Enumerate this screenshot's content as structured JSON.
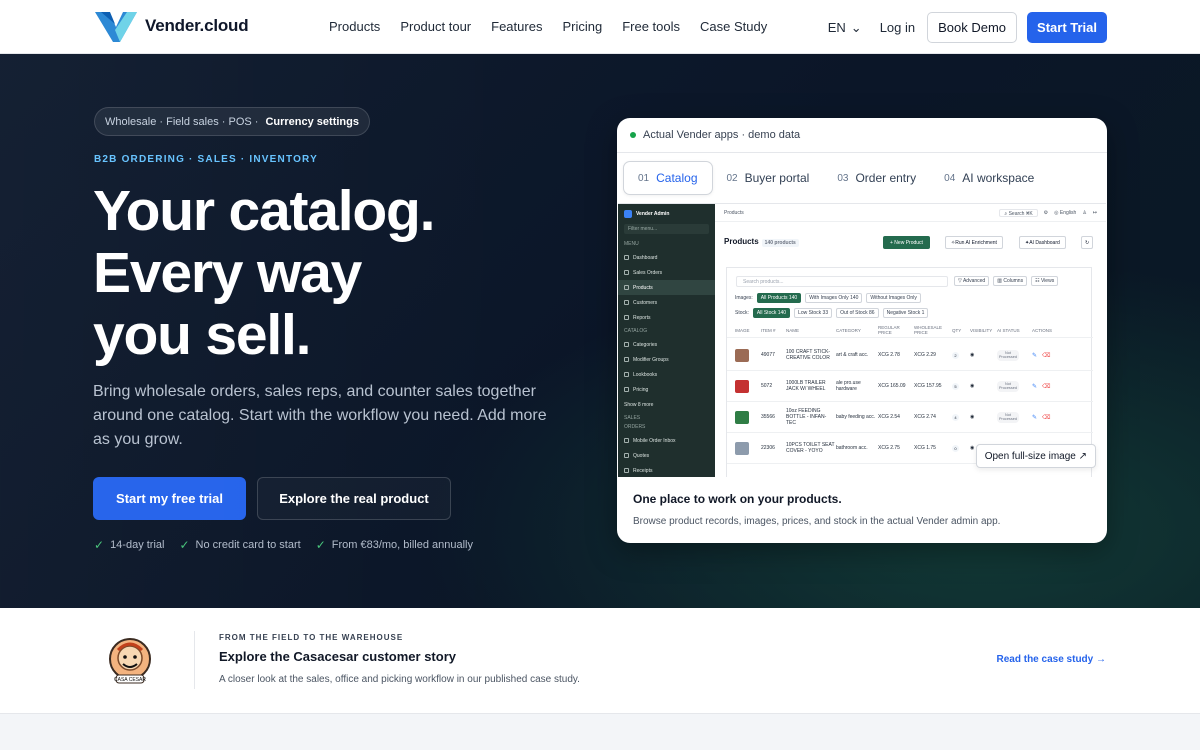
{
  "nav": {
    "brand": "Vender.cloud",
    "items": [
      "Products",
      "Product tour",
      "Features",
      "Pricing",
      "Free tools",
      "Case Study"
    ],
    "language": "EN",
    "login": "Log in",
    "book_demo": "Book Demo",
    "start_trial": "Start Trial",
    "colors": {
      "accent": "#2563eb"
    }
  },
  "hero": {
    "chips": [
      "Wholesale · Field sales · POS ·",
      "Currency settings"
    ],
    "eyebrow": "B2B ORDERING · SALES · INVENTORY",
    "headline": [
      "Your catalog.",
      "Every way",
      "you sell."
    ],
    "lead": "Bring wholesale orders, sales reps, and counter sales together around one catalog. Start with the workflow you need. Add more as you grow.",
    "primary_cta": "Start my free trial",
    "secondary_cta": "Explore the real product",
    "checks": [
      "14-day trial",
      "No credit card to start",
      "From €83/mo, billed annually"
    ],
    "colors": {
      "eyebrow": "#66c3ff",
      "check": "#47c47a"
    }
  },
  "demo_card": {
    "status": "Actual Vender apps · demo data",
    "tabs": [
      {
        "num": "01",
        "label": "Catalog"
      },
      {
        "num": "02",
        "label": "Buyer portal"
      },
      {
        "num": "03",
        "label": "Order entry"
      },
      {
        "num": "04",
        "label": "AI workspace"
      }
    ],
    "screenshot": {
      "sidebar": {
        "title": "Vender Admin",
        "search": "Filter menu...",
        "sections": [
          "MENU",
          "CATALOG",
          "SALES",
          "ORDERS"
        ],
        "items": [
          "Dashboard",
          "Sales Orders",
          "Products",
          "Customers",
          "Reports",
          "Categories",
          "Modifier Groups",
          "Lookbooks",
          "Pricing",
          "Show 8 more",
          "Mobile Order Inbox",
          "Quotes",
          "Receipts"
        ]
      },
      "breadcrumb": "Products",
      "top_search": "Search",
      "top_shortcut": "⌘K",
      "language": "English",
      "title": "Products",
      "count": "140 products",
      "buttons": [
        "+ New Product",
        "Run AI Enrichment",
        "AI Dashboard"
      ],
      "search_placeholder": "Search products...",
      "toolbar": [
        "Advanced",
        "Columns",
        "Views"
      ],
      "images_label": "Images:",
      "images_filters": [
        "All Products 140",
        "With Images Only 140",
        "Without Images Only"
      ],
      "stock_label": "Stock:",
      "stock_filters": [
        "All Stock 140",
        "Low Stock 33",
        "Out of Stock 86",
        "Negative Stock 1"
      ],
      "columns": [
        "IMAGE",
        "ITEM #",
        "NAME",
        "CATEGORY",
        "REGULAR PRICE",
        "WHOLESALE PRICE",
        "QTY",
        "VISIBILITY",
        "AI STATUS",
        "ACTIONS"
      ],
      "rows": [
        {
          "item": "49077",
          "name": "100 CRAFT STICK-CREATIVE COLOR",
          "category": "art & craft acc.",
          "regular": "XCG 2.78",
          "wholesale": "XCG 2.29",
          "qty": "2",
          "status": "Not Processed",
          "thumb": "#9b6b55"
        },
        {
          "item": "5072",
          "name": "1000LB TRAILER JACK W/ WHEEL",
          "category": "ale pro.use hardware",
          "regular": "XCG 165.09",
          "wholesale": "XCG 157.95",
          "qty": "5",
          "status": "Not Processed",
          "thumb": "#c43131"
        },
        {
          "item": "35566",
          "name": "10oz FEEDING BOTTLE - INFAN-TEC",
          "category": "baby feeding acc.",
          "regular": "XCG 2.54",
          "wholesale": "XCG 2.74",
          "qty": "4",
          "status": "Not Processed",
          "thumb": "#2f7d45"
        },
        {
          "item": "22306",
          "name": "10PCS TOILET SEAT COVER - YOYO",
          "category": "bathroom acc.",
          "regular": "XCG 2.75",
          "wholesale": "XCG 1.75",
          "qty": "0",
          "status": "",
          "thumb": "#8d9bac"
        }
      ]
    },
    "open_image": "Open full-size image ↗",
    "caption_title": "One place to work on your products.",
    "caption_text": "Browse product records, images, prices, and stock in the actual Vender admin app."
  },
  "story": {
    "eyebrow": "FROM THE FIELD TO THE WAREHOUSE",
    "title": "Explore the Casacesar customer story",
    "text": "A closer look at the sales, office and picking workflow in our published case study.",
    "link": "Read the case study →"
  }
}
